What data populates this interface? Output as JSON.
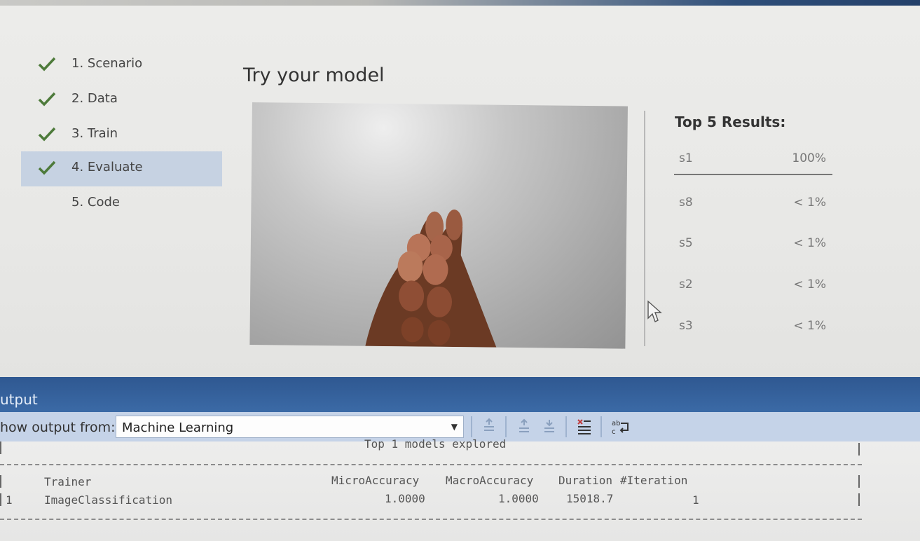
{
  "steps": [
    {
      "label": "1. Scenario",
      "done": true
    },
    {
      "label": "2. Data",
      "done": true
    },
    {
      "label": "3. Train",
      "done": true
    },
    {
      "label": "4. Evaluate",
      "done": true,
      "selected": true
    },
    {
      "label": "5. Code",
      "done": false
    }
  ],
  "main": {
    "title": "Try your model"
  },
  "results": {
    "title": "Top 5 Results:",
    "rows": [
      {
        "label": "s1",
        "value": "100%"
      },
      {
        "label": "s8",
        "value": "< 1%"
      },
      {
        "label": "s5",
        "value": "< 1%"
      },
      {
        "label": "s2",
        "value": "< 1%"
      },
      {
        "label": "s3",
        "value": "< 1%"
      }
    ]
  },
  "output": {
    "title": "utput",
    "show_from_label": "how output from:",
    "source": "Machine Learning"
  },
  "console": {
    "heading": "Top 1 models explored",
    "headers": [
      "Trainer",
      "MicroAccuracy",
      "MacroAccuracy",
      "Duration",
      "#Iteration"
    ],
    "rows": [
      {
        "index": "1",
        "trainer": "ImageClassification",
        "micro": "1.0000",
        "macro": "1.0000",
        "duration": "15018.7",
        "iteration": "1"
      }
    ]
  },
  "colors": {
    "check": "#4d7a3a",
    "selected_step": "#c6d2e2",
    "output_title_bar": "#2f5891"
  }
}
